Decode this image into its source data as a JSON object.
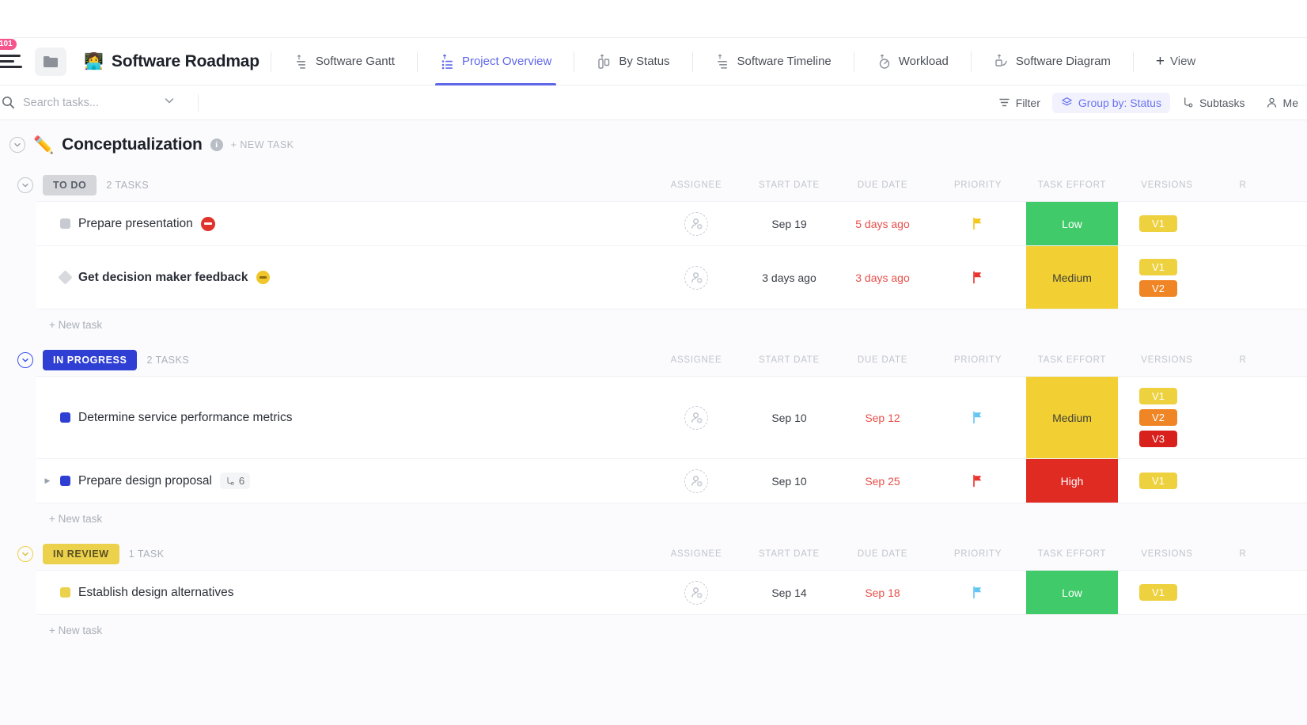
{
  "topbar": {
    "notification_count": "101",
    "folder_icon": "folder-icon",
    "space_emoji": "👩‍💻",
    "space_title": "Software Roadmap",
    "tabs": [
      {
        "label": "Software Gantt",
        "icon": "gantt-icon",
        "active": false
      },
      {
        "label": "Project Overview",
        "icon": "list-icon",
        "active": true
      },
      {
        "label": "By Status",
        "icon": "board-icon",
        "active": false
      },
      {
        "label": "Software Timeline",
        "icon": "timeline-icon",
        "active": false
      },
      {
        "label": "Workload",
        "icon": "workload-icon",
        "active": false
      },
      {
        "label": "Software Diagram",
        "icon": "diagram-icon",
        "active": false
      }
    ],
    "add_view_label": "View",
    "add_view_icon": "plus-icon"
  },
  "toolbar": {
    "search_placeholder": "Search tasks...",
    "search_value": "",
    "search_icon": "search-icon",
    "chevron_icon": "chevron-down-icon",
    "buttons": [
      {
        "label": "Filter",
        "icon": "filter-icon",
        "accent": false
      },
      {
        "label": "Group by: Status",
        "icon": "layers-icon",
        "accent": true
      },
      {
        "label": "Subtasks",
        "icon": "subtask-icon",
        "accent": false
      },
      {
        "label": "Me",
        "icon": "person-icon",
        "accent": false
      }
    ]
  },
  "list": {
    "emoji": "✏️",
    "name": "Conceptualization",
    "info_glyph": "i",
    "new_task_label": "+ NEW TASK"
  },
  "columns": [
    "ASSIGNEE",
    "START DATE",
    "DUE DATE",
    "PRIORITY",
    "TASK EFFORT",
    "VERSIONS",
    "R"
  ],
  "new_task_label": "+ New task",
  "groups": [
    {
      "status": "TO DO",
      "pill_class": "pill-todo",
      "circle_class": "todo",
      "count_label": "2 TASKS",
      "tasks": [
        {
          "name": "Prepare presentation",
          "bold": false,
          "status_color": "#c7cad0",
          "badge": "stop",
          "expandable": false,
          "subtasks": null,
          "start_date": "Sep 19",
          "due_date": "5 days ago",
          "due_overdue": true,
          "priority_color": "#f5c518",
          "effort": "Low",
          "effort_class": "effort-low",
          "versions": [
            "V1"
          ]
        },
        {
          "name": "Get decision maker feedback",
          "bold": true,
          "status_color": "#d6d9de",
          "badge": "dash",
          "expandable": false,
          "subtasks": null,
          "start_date": "3 days ago",
          "due_date": "3 days ago",
          "due_overdue": true,
          "priority_color": "#e8342c",
          "effort": "Medium",
          "effort_class": "effort-med",
          "versions": [
            "V1",
            "V2"
          ]
        }
      ]
    },
    {
      "status": "IN PROGRESS",
      "pill_class": "pill-prog",
      "circle_class": "prog",
      "count_label": "2 TASKS",
      "tasks": [
        {
          "name": "Determine service performance metrics",
          "bold": false,
          "status_color": "#2f3fd4",
          "badge": null,
          "expandable": false,
          "subtasks": null,
          "start_date": "Sep 10",
          "due_date": "Sep 12",
          "due_overdue": true,
          "priority_color": "#62c6f2",
          "effort": "Medium",
          "effort_class": "effort-med",
          "versions": [
            "V1",
            "V2",
            "V3"
          ]
        },
        {
          "name": "Prepare design proposal",
          "bold": false,
          "status_color": "#2f3fd4",
          "badge": null,
          "expandable": true,
          "subtasks": "6",
          "start_date": "Sep 10",
          "due_date": "Sep 25",
          "due_overdue": true,
          "priority_color": "#e8342c",
          "effort": "High",
          "effort_class": "effort-high",
          "versions": [
            "V1"
          ]
        }
      ]
    },
    {
      "status": "IN REVIEW",
      "pill_class": "pill-rev",
      "circle_class": "rev",
      "count_label": "1 TASK",
      "tasks": [
        {
          "name": "Establish design alternatives",
          "bold": false,
          "status_color": "#ecd14c",
          "badge": null,
          "expandable": false,
          "subtasks": null,
          "start_date": "Sep 14",
          "due_date": "Sep 18",
          "due_overdue": true,
          "priority_color": "#62c6f2",
          "effort": "Low",
          "effort_class": "effort-low",
          "versions": [
            "V1"
          ]
        }
      ]
    }
  ],
  "colors": {
    "accent": "#5f67e8",
    "in_progress": "#2f3fd4",
    "in_review": "#ecd14c",
    "overdue": "#e8504a",
    "effort_low": "#41ca6a",
    "effort_medium": "#f2d033",
    "effort_high": "#e02b23",
    "version_v1": "#eed13f",
    "version_v2": "#ef8524",
    "version_v3": "#d8201c",
    "notification": "#f5548c"
  }
}
